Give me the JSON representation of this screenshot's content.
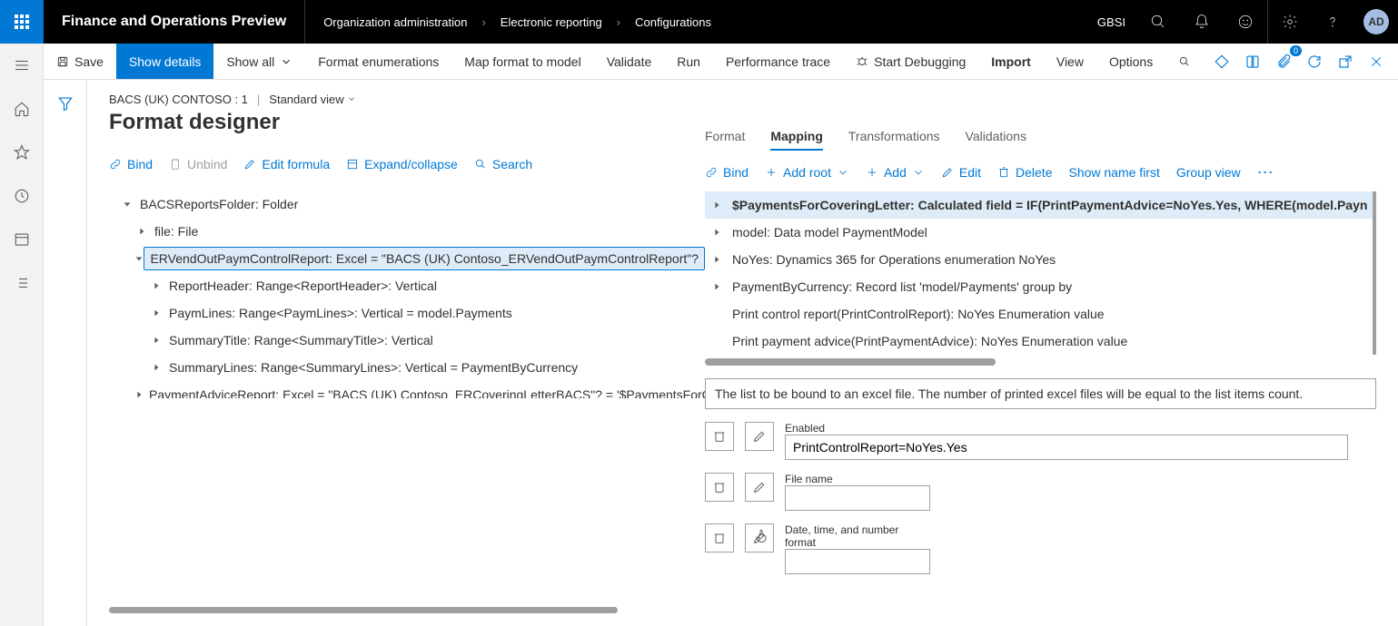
{
  "top": {
    "app_title": "Finance and Operations Preview",
    "breadcrumbs": [
      "Organization administration",
      "Electronic reporting",
      "Configurations"
    ],
    "company": "GBSI",
    "avatar": "AD"
  },
  "cmd": {
    "save": "Save",
    "show_details": "Show details",
    "show_all": "Show all",
    "format_enum": "Format enumerations",
    "map_format": "Map format to model",
    "validate": "Validate",
    "run": "Run",
    "perf_trace": "Performance trace",
    "start_debug": "Start Debugging",
    "import": "Import",
    "view": "View",
    "options": "Options",
    "badge": "0"
  },
  "context": {
    "config": "BACS (UK) CONTOSO : 1",
    "view": "Standard view"
  },
  "page_title": "Format designer",
  "left_toolbar": {
    "bind": "Bind",
    "unbind": "Unbind",
    "edit_formula": "Edit formula",
    "expand_collapse": "Expand/collapse",
    "search": "Search"
  },
  "tree": [
    {
      "indent": 0,
      "exp": "open",
      "label": "BACSReportsFolder: Folder"
    },
    {
      "indent": 1,
      "exp": "closed",
      "label": "file: File"
    },
    {
      "indent": 1,
      "exp": "open",
      "label": "ERVendOutPaymControlReport: Excel = \"BACS (UK) Contoso_ERVendOutPaymControlReport\"?",
      "selected": true
    },
    {
      "indent": 2,
      "exp": "closed",
      "label": "ReportHeader: Range<ReportHeader>: Vertical"
    },
    {
      "indent": 2,
      "exp": "closed",
      "label": "PaymLines: Range<PaymLines>: Vertical = model.Payments"
    },
    {
      "indent": 2,
      "exp": "closed",
      "label": "SummaryTitle: Range<SummaryTitle>: Vertical"
    },
    {
      "indent": 2,
      "exp": "closed",
      "label": "SummaryLines: Range<SummaryLines>: Vertical = PaymentByCurrency"
    },
    {
      "indent": 1,
      "exp": "closed",
      "label": "PaymentAdviceReport: Excel = \"BACS (UK) Contoso_ERCoveringLetterBACS\"? = '$PaymentsForCo"
    }
  ],
  "tabs": {
    "format": "Format",
    "mapping": "Mapping",
    "transformations": "Transformations",
    "validations": "Validations",
    "active": "mapping"
  },
  "right_toolbar": {
    "bind": "Bind",
    "add_root": "Add root",
    "add": "Add",
    "edit": "Edit",
    "delete": "Delete",
    "show_name": "Show name first",
    "group_view": "Group view"
  },
  "mapping_rows": [
    {
      "exp": true,
      "label": "$PaymentsForCoveringLetter: Calculated field = IF(PrintPaymentAdvice=NoYes.Yes, WHERE(model.Payn",
      "selected": true
    },
    {
      "exp": true,
      "label": "model: Data model PaymentModel"
    },
    {
      "exp": true,
      "label": "NoYes: Dynamics 365 for Operations enumeration NoYes"
    },
    {
      "exp": true,
      "label": "PaymentByCurrency: Record list 'model/Payments' group by"
    },
    {
      "exp": false,
      "label": "Print control report(PrintControlReport): NoYes Enumeration value"
    },
    {
      "exp": false,
      "label": "Print payment advice(PrintPaymentAdvice): NoYes Enumeration value"
    }
  ],
  "description": "The list to be bound to an excel file. The number of printed excel files will be equal to the list items count.",
  "props": {
    "enabled_label": "Enabled",
    "enabled_value": "PrintControlReport=NoYes.Yes",
    "filename_label": "File name",
    "filename_value": "",
    "dateformat_label": "Date, time, and number format",
    "dateformat_value": ""
  }
}
